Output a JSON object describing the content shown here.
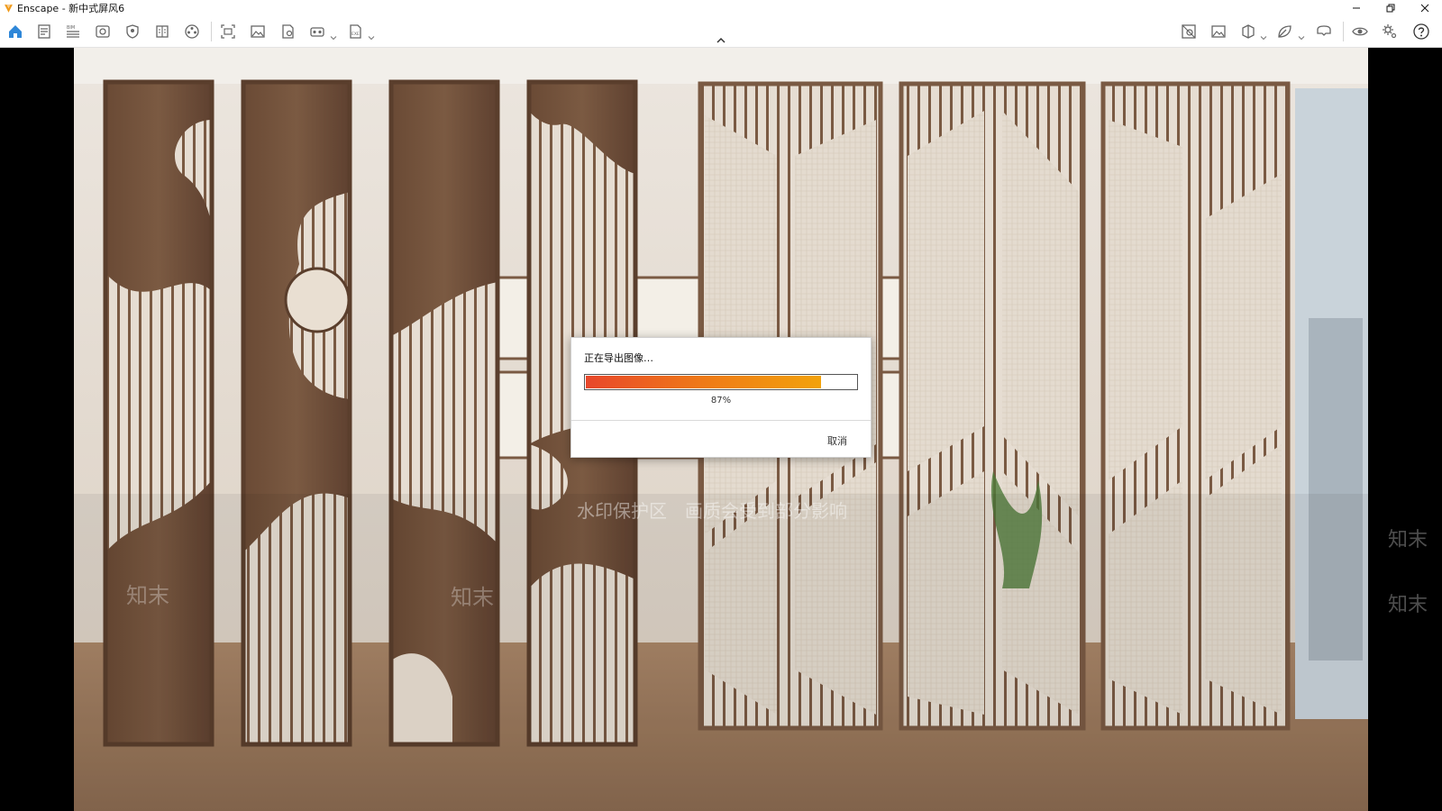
{
  "window": {
    "app_name": "Enscape",
    "title": "Enscape - 新中式屏风6",
    "controls": [
      "minimize",
      "restore",
      "close"
    ]
  },
  "toolbar": {
    "left_icons": [
      {
        "name": "home-icon",
        "active": true
      },
      {
        "name": "document-icon"
      },
      {
        "name": "bim-icon",
        "label": "BIM"
      },
      {
        "name": "view-icon"
      },
      {
        "name": "shield-icon"
      },
      {
        "name": "book-icon"
      },
      {
        "name": "film-reel-icon"
      },
      {
        "name": "screenshot-icon"
      },
      {
        "name": "image-icon"
      },
      {
        "name": "batch-render-icon"
      },
      {
        "name": "panorama-icon"
      },
      {
        "name": "export-exe-icon",
        "label": "EXE"
      }
    ],
    "right_icons": [
      {
        "name": "map-icon"
      },
      {
        "name": "gallery-icon"
      },
      {
        "name": "cube-icon"
      },
      {
        "name": "leaf-icon"
      },
      {
        "name": "vr-headset-icon"
      },
      {
        "name": "eye-icon"
      },
      {
        "name": "settings-icon"
      },
      {
        "name": "help-icon"
      }
    ]
  },
  "watermark": {
    "banner": "水印保护区　画质会受到部分影响",
    "mark": "知末"
  },
  "dialog": {
    "title": "正在导出图像…",
    "progress": 0.87,
    "progress_text": "87%",
    "cancel_label": "取消"
  },
  "colors": {
    "accent": "#2f87d8",
    "progress_start": "#e8472b",
    "progress_end": "#f2a20b"
  }
}
